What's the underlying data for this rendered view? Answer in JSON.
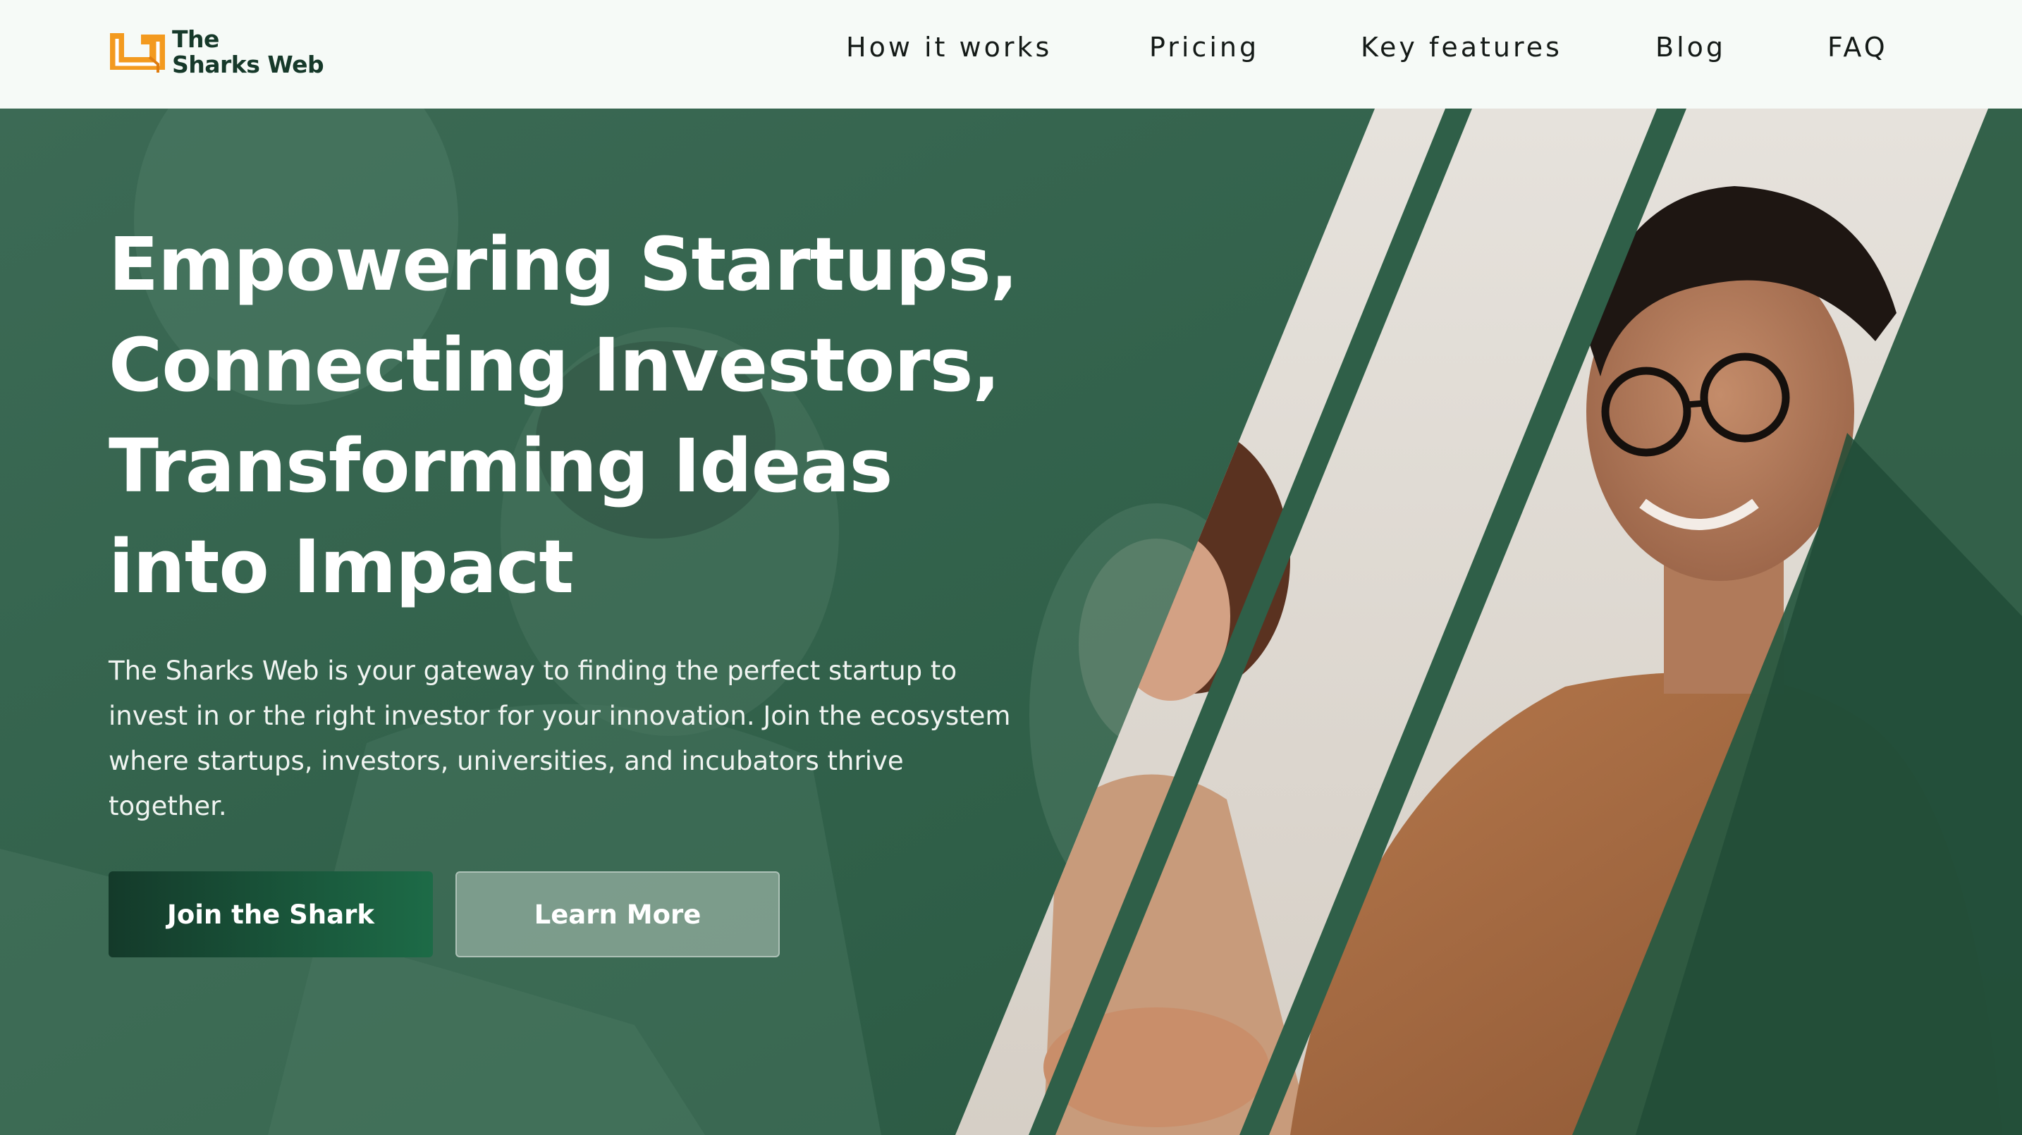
{
  "brand": {
    "name_line1": "The",
    "name_line2": "Sharks Web",
    "accent_color": "#f39a1f",
    "primary_color": "#1f5c44"
  },
  "nav": {
    "items": [
      {
        "label": "How it works"
      },
      {
        "label": "Pricing"
      },
      {
        "label": "Key features"
      },
      {
        "label": "Blog"
      },
      {
        "label": "FAQ"
      }
    ]
  },
  "hero": {
    "headline_lines": [
      "Empowering Startups,",
      "Connecting Investors,",
      "Transforming Ideas",
      "into Impact"
    ],
    "subtext": "The Sharks Web is your gateway to finding the perfect startup to invest in or the right investor for your innovation. Join the ecosystem where startups, investors, universities, and incubators thrive together.",
    "primary_button": "Join the Shark",
    "secondary_button": "Learn More",
    "overlay_color": "#2f5e47"
  }
}
